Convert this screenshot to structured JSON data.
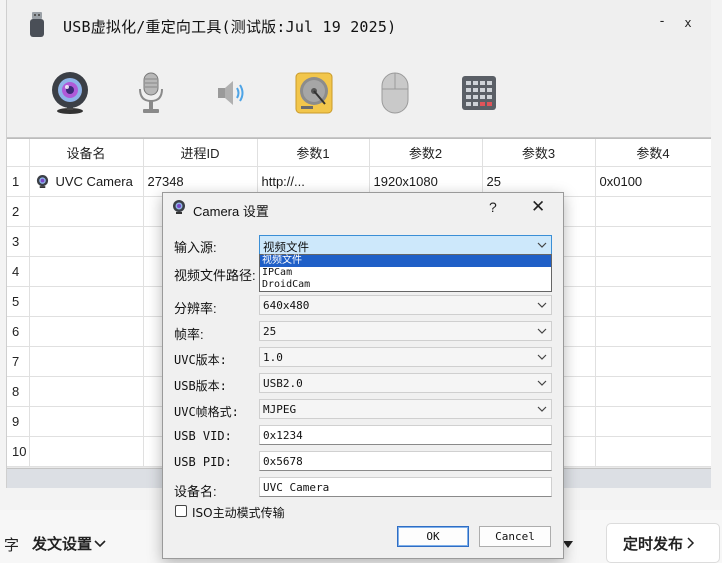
{
  "window": {
    "title": "USB虚拟化/重定向工具(测试版:Jul 19 2025)",
    "minimize_glyph": "-",
    "close_glyph": "x"
  },
  "toolbar": {
    "buttons": [
      {
        "name": "webcam-icon"
      },
      {
        "name": "microphone-icon"
      },
      {
        "name": "speaker-icon"
      },
      {
        "name": "hard-disk-icon"
      },
      {
        "name": "mouse-icon"
      },
      {
        "name": "keypad-icon"
      }
    ]
  },
  "grid": {
    "columns": [
      "",
      "设备名",
      "进程ID",
      "参数1",
      "参数2",
      "参数3",
      "参数4"
    ],
    "rows": [
      {
        "num": "1",
        "device": "UVC Camera",
        "pid": "27348",
        "p1": "http://...",
        "p2": "1920x1080",
        "p3": "25",
        "p4": "0x0100"
      },
      {
        "num": "2",
        "device": "",
        "pid": "",
        "p1": "",
        "p2": "",
        "p3": "",
        "p4": ""
      },
      {
        "num": "3",
        "device": "",
        "pid": "",
        "p1": "",
        "p2": "",
        "p3": "",
        "p4": ""
      },
      {
        "num": "4",
        "device": "",
        "pid": "",
        "p1": "",
        "p2": "",
        "p3": "",
        "p4": ""
      },
      {
        "num": "5",
        "device": "",
        "pid": "",
        "p1": "",
        "p2": "",
        "p3": "",
        "p4": ""
      },
      {
        "num": "6",
        "device": "",
        "pid": "",
        "p1": "",
        "p2": "",
        "p3": "",
        "p4": ""
      },
      {
        "num": "7",
        "device": "",
        "pid": "",
        "p1": "",
        "p2": "",
        "p3": "",
        "p4": ""
      },
      {
        "num": "8",
        "device": "",
        "pid": "",
        "p1": "",
        "p2": "",
        "p3": "",
        "p4": ""
      },
      {
        "num": "9",
        "device": "",
        "pid": "",
        "p1": "",
        "p2": "",
        "p3": "",
        "p4": ""
      },
      {
        "num": "10",
        "device": "",
        "pid": "",
        "p1": "",
        "p2": "",
        "p3": "",
        "p4": ""
      }
    ]
  },
  "background_app": {
    "left_text": "字",
    "publish_settings": "发文设置",
    "schedule_publish": "定时发布"
  },
  "dialog": {
    "title": "Camera 设置",
    "help": "?",
    "close": "✕",
    "source_label": "输入源:",
    "source_value": "视频文件",
    "source_options": [
      "视频文件",
      "IPCam",
      "DroidCam"
    ],
    "file_path_label": "视频文件路径:",
    "resolution_label": "分辨率:",
    "resolution_value": "640x480",
    "fps_label": "帧率:",
    "fps_value": "25",
    "uvc_version_label": "UVC版本:",
    "uvc_version_value": "1.0",
    "usb_version_label": "USB版本:",
    "usb_version_value": "USB2.0",
    "uvc_format_label": "UVC帧格式:",
    "uvc_format_value": "MJPEG",
    "vid_label": "USB VID:",
    "vid_value": "0x1234",
    "pid_label": "USB PID:",
    "pid_value": "0x5678",
    "device_name_label": "设备名:",
    "device_name_value": "UVC Camera",
    "iso_label": "ISO主动模式传输",
    "iso_checked": false,
    "ok_label": "OK",
    "cancel_label": "Cancel"
  }
}
